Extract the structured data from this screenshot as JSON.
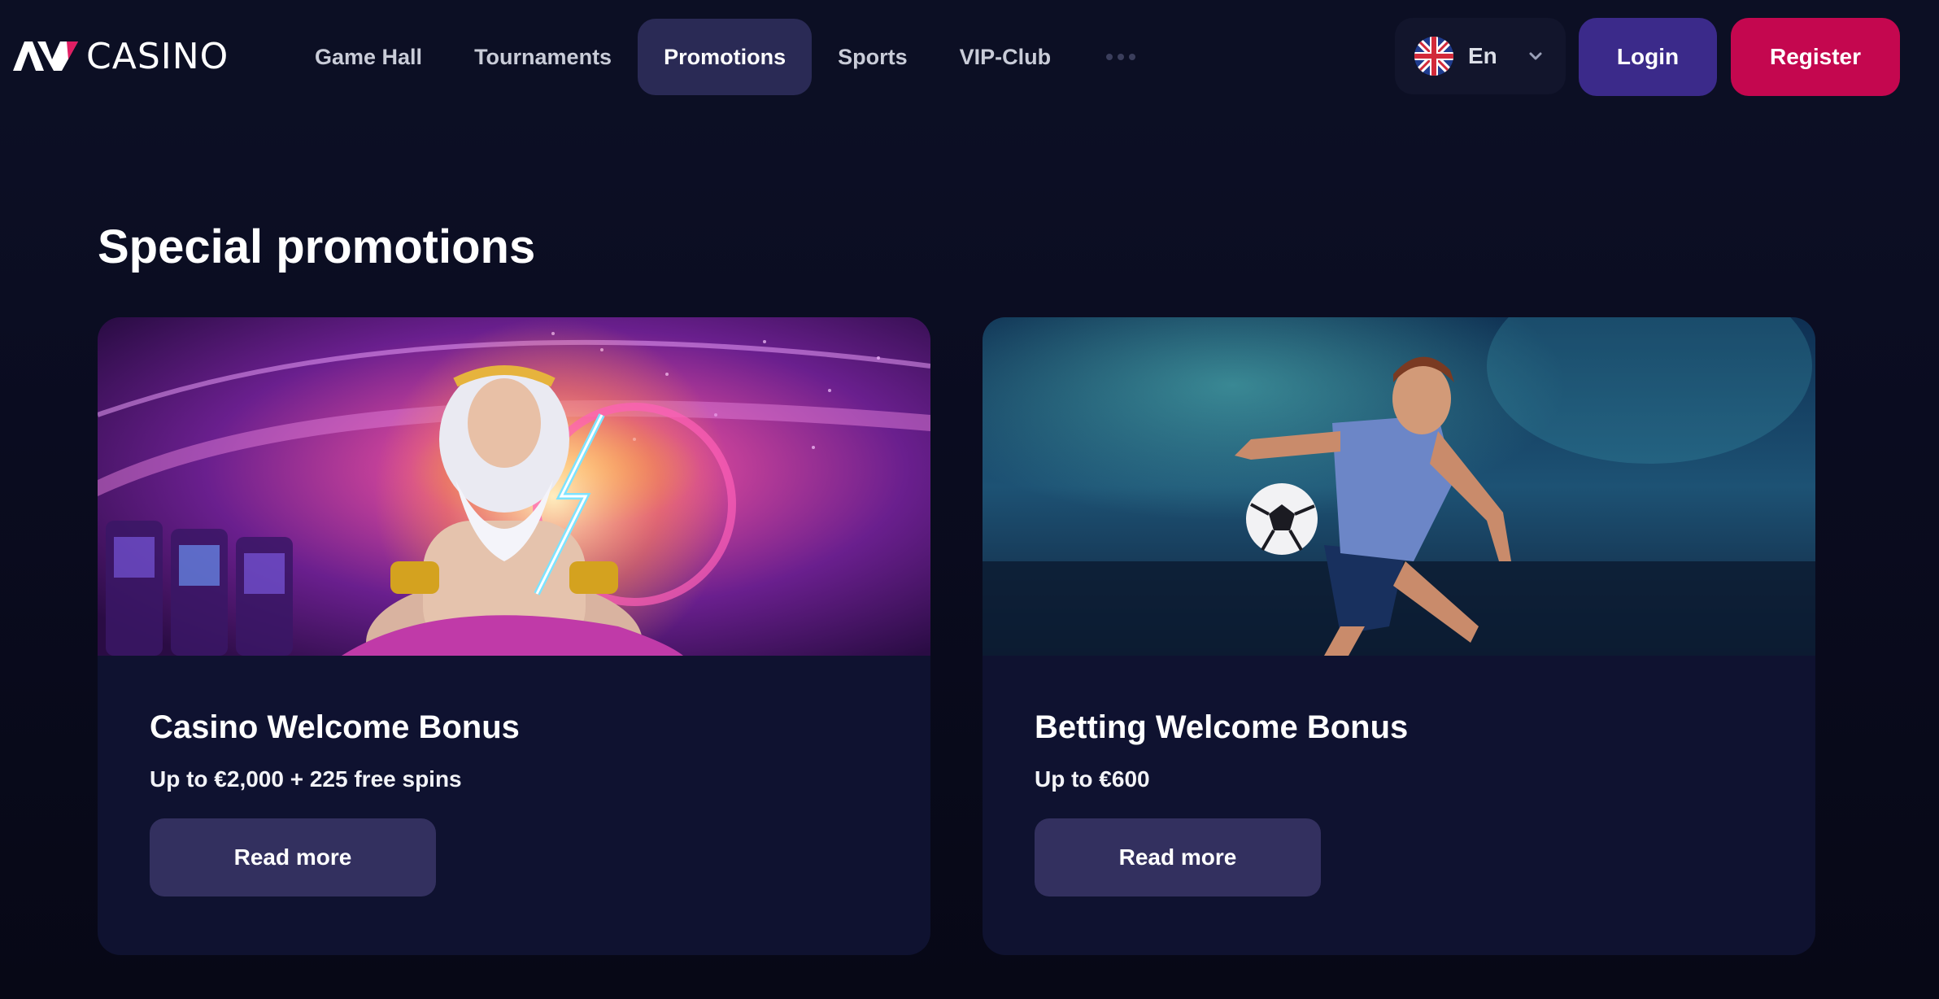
{
  "header": {
    "logo_text": "CASINO",
    "nav": [
      {
        "label": "Game Hall"
      },
      {
        "label": "Tournaments"
      },
      {
        "label": "Promotions",
        "active": true
      },
      {
        "label": "Sports"
      },
      {
        "label": "VIP-Club"
      }
    ],
    "language": {
      "label": "En",
      "flag": "uk-flag-icon"
    },
    "login_label": "Login",
    "register_label": "Register"
  },
  "main": {
    "title": "Special promotions",
    "cards": [
      {
        "title": "Casino Welcome Bonus",
        "subtitle": "Up to €2,000 + 225 free spins",
        "button_label": "Read more"
      },
      {
        "title": "Betting Welcome Bonus",
        "subtitle": "Up to €600",
        "button_label": "Read more"
      }
    ]
  },
  "colors": {
    "background": "#0a0c1e",
    "header": "#0c0f24",
    "nav_active": "#2a2a55",
    "login": "#3b2a8a",
    "register": "#c4074f",
    "card": "#0f1230",
    "card_button": "#33305f"
  }
}
